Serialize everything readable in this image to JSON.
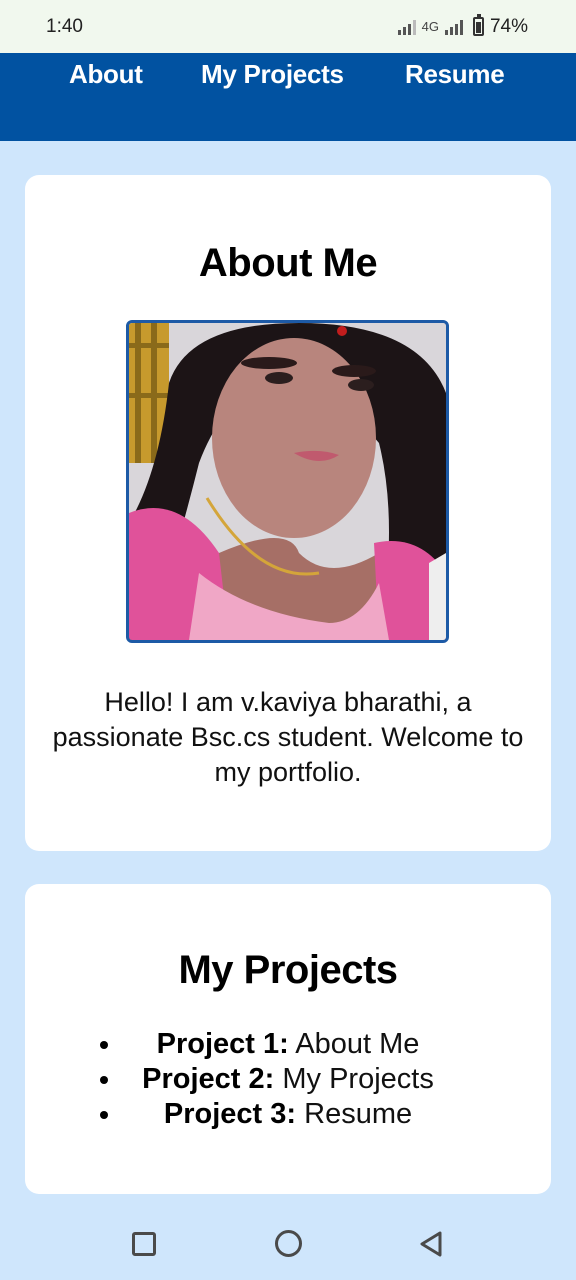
{
  "status_bar": {
    "time": "1:40",
    "network": "4G",
    "battery": "74%"
  },
  "nav": {
    "about": "About",
    "projects": "My Projects",
    "resume": "Resume"
  },
  "about": {
    "title": "About Me",
    "photo_alt": "profile photo",
    "text": "Hello! I am v.kaviya bharathi, a passionate Bsc.cs student. Welcome to my portfolio."
  },
  "projects": {
    "title": "My Projects",
    "items": [
      {
        "name": "Project 1:",
        "desc": " About Me"
      },
      {
        "name": "Project 2:",
        "desc": " My Projects"
      },
      {
        "name": "Project 3:",
        "desc": " Resume"
      }
    ]
  },
  "colors": {
    "nav_background": "#0152a1",
    "page_background": "#cfe6fc",
    "card_background": "#ffffff"
  },
  "icons": {
    "recent_apps": "square-icon",
    "home": "circle-icon",
    "back": "triangle-back-icon"
  }
}
